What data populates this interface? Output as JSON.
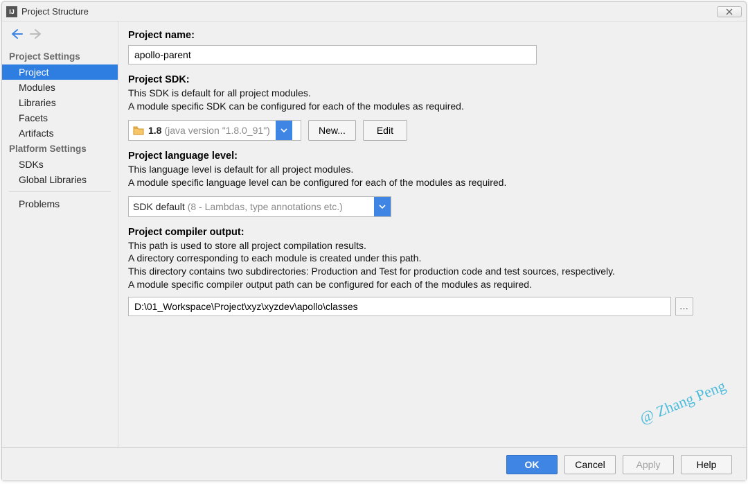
{
  "window": {
    "title": "Project Structure"
  },
  "sidebar": {
    "section1": "Project Settings",
    "items1": [
      {
        "label": "Project",
        "selected": true
      },
      {
        "label": "Modules",
        "selected": false
      },
      {
        "label": "Libraries",
        "selected": false
      },
      {
        "label": "Facets",
        "selected": false
      },
      {
        "label": "Artifacts",
        "selected": false
      }
    ],
    "section2": "Platform Settings",
    "items2": [
      {
        "label": "SDKs",
        "selected": false
      },
      {
        "label": "Global Libraries",
        "selected": false
      }
    ],
    "items3": [
      {
        "label": "Problems",
        "selected": false
      }
    ]
  },
  "main": {
    "projectName": {
      "label": "Project name:",
      "value": "apollo-parent"
    },
    "projectSdk": {
      "label": "Project SDK:",
      "desc1": "This SDK is default for all project modules.",
      "desc2": "A module specific SDK can be configured for each of the modules as required.",
      "selectedPrimary": "1.8",
      "selectedSecondary": "(java version \"1.8.0_91\")",
      "newBtn": "New...",
      "editBtn": "Edit"
    },
    "langLevel": {
      "label": "Project language level:",
      "desc1": "This language level is default for all project modules.",
      "desc2": "A module specific language level can be configured for each of the modules as required.",
      "selectedPrimary": "SDK default",
      "selectedSecondary": "(8 - Lambdas, type annotations etc.)"
    },
    "compilerOutput": {
      "label": "Project compiler output:",
      "desc1": "This path is used to store all project compilation results.",
      "desc2": "A directory corresponding to each module is created under this path.",
      "desc3": "This directory contains two subdirectories: Production and Test for production code and test sources, respectively.",
      "desc4": "A module specific compiler output path can be configured for each of the modules as required.",
      "value": "D:\\01_Workspace\\Project\\xyz\\xyzdev\\apollo\\classes",
      "browse": "..."
    }
  },
  "footer": {
    "ok": "OK",
    "cancel": "Cancel",
    "apply": "Apply",
    "help": "Help"
  },
  "watermark": "@ Zhang Peng"
}
